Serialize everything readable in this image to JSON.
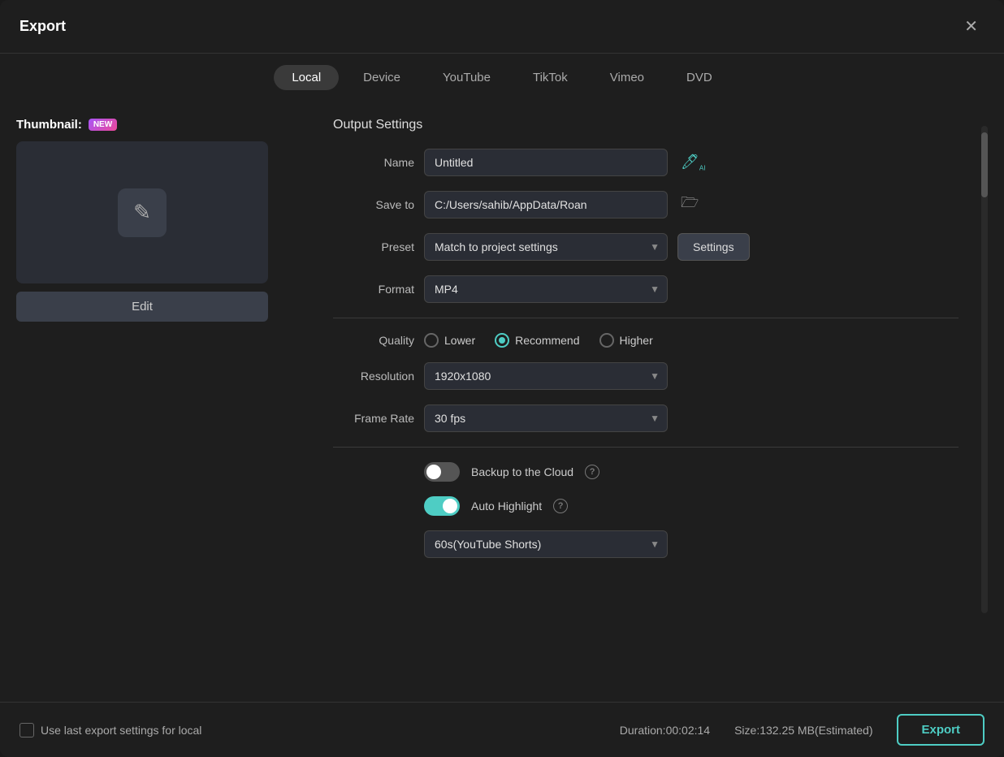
{
  "dialog": {
    "title": "Export",
    "close_label": "✕"
  },
  "tabs": [
    {
      "id": "local",
      "label": "Local",
      "active": true
    },
    {
      "id": "device",
      "label": "Device",
      "active": false
    },
    {
      "id": "youtube",
      "label": "YouTube",
      "active": false
    },
    {
      "id": "tiktok",
      "label": "TikTok",
      "active": false
    },
    {
      "id": "vimeo",
      "label": "Vimeo",
      "active": false
    },
    {
      "id": "dvd",
      "label": "DVD",
      "active": false
    }
  ],
  "thumbnail": {
    "label": "Thumbnail:",
    "badge": "NEW",
    "edit_label": "Edit"
  },
  "output_settings": {
    "section_title": "Output Settings",
    "name_label": "Name",
    "name_value": "Untitled",
    "save_to_label": "Save to",
    "save_to_value": "C:/Users/sahib/AppData/Roan",
    "preset_label": "Preset",
    "preset_value": "Match to project settings",
    "settings_btn_label": "Settings",
    "format_label": "Format",
    "format_value": "MP4",
    "quality_label": "Quality",
    "quality_options": [
      {
        "id": "lower",
        "label": "Lower",
        "checked": false
      },
      {
        "id": "recommend",
        "label": "Recommend",
        "checked": true
      },
      {
        "id": "higher",
        "label": "Higher",
        "checked": false
      }
    ],
    "resolution_label": "Resolution",
    "resolution_value": "1920x1080",
    "frame_rate_label": "Frame Rate",
    "frame_rate_value": "30 fps",
    "backup_label": "Backup to the Cloud",
    "backup_on": false,
    "auto_highlight_label": "Auto Highlight",
    "auto_highlight_on": true,
    "highlight_duration_value": "60s(YouTube Shorts)"
  },
  "footer": {
    "checkbox_label": "Use last export settings for local",
    "duration_label": "Duration:00:02:14",
    "size_label": "Size:132.25 MB(Estimated)",
    "export_label": "Export"
  }
}
